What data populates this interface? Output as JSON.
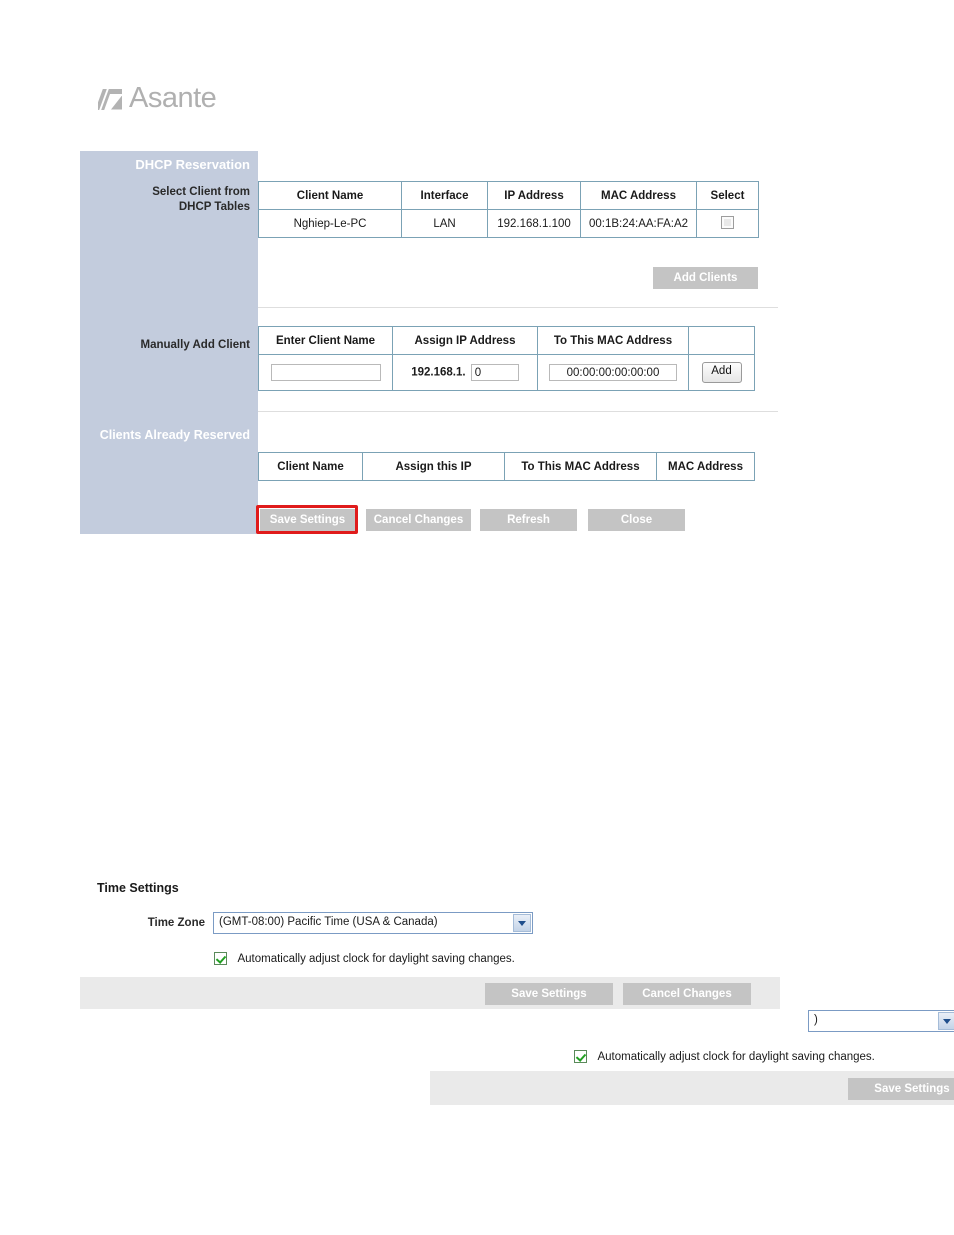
{
  "brand": {
    "name": "Asante",
    "logo_icon": "asante-logo-icon"
  },
  "dhcp_panel": {
    "section_title": "DHCP Reservation",
    "labels": {
      "select_client": "Select Client from DHCP Tables",
      "select_client_line1": "Select Client from",
      "select_client_line2": "DHCP Tables",
      "manually_add_client": "Manually Add Client",
      "clients_already_reserved": "Clients Already Reserved"
    },
    "dhcp_table": {
      "headers": [
        "Client Name",
        "Interface",
        "IP Address",
        "MAC Address",
        "Select"
      ],
      "rows": [
        {
          "client_name": "Nghiep-Le-PC",
          "interface": "LAN",
          "ip_address": "192.168.1.100",
          "mac_address": "00:1B:24:AA:FA:A2",
          "selected": false
        }
      ],
      "add_clients_label": "Add Clients"
    },
    "manual_add": {
      "headers": [
        "Enter Client Name",
        "Assign IP Address",
        "To This MAC Address",
        ""
      ],
      "client_name_value": "",
      "client_name_placeholder": "",
      "ip_prefix": "192.168.1.",
      "ip_suffix_value": "0",
      "mac_value": "00:00:00:00:00:00",
      "add_button_label": "Add"
    },
    "reserved_table": {
      "headers": [
        "Client Name",
        "Assign this IP",
        "To This MAC Address",
        "MAC Address"
      ],
      "rows": []
    },
    "buttons": [
      {
        "label": "Save Settings",
        "highlighted": true
      },
      {
        "label": "Cancel Changes",
        "highlighted": false
      },
      {
        "label": "Refresh",
        "highlighted": false
      },
      {
        "label": "Close",
        "highlighted": false
      }
    ],
    "highlight_color": "#e01b1b"
  },
  "time_settings_primary": {
    "title": "Time Settings",
    "time_zone_label": "Time Zone",
    "time_zone_value": "(GMT-08:00) Pacific Time (USA & Canada)",
    "dst_checked": true,
    "dst_label": "Automatically adjust clock for daylight saving changes.",
    "save_label": "Save Settings",
    "cancel_label": "Cancel Changes"
  },
  "time_settings_overlay": {
    "time_zone_value_clipped": ")",
    "dst_checked": true,
    "dst_label": "Automatically adjust clock for daylight saving changes.",
    "save_label": "Save Settings"
  }
}
